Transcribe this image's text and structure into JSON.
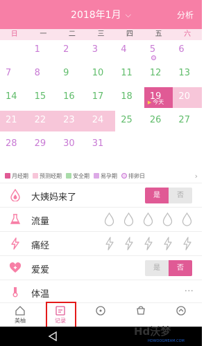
{
  "header": {
    "title": "2018年1月",
    "analysis": "分析"
  },
  "weekdays": [
    "日",
    "一",
    "二",
    "三",
    "四",
    "五",
    "六"
  ],
  "calendar": {
    "rows": [
      [
        "",
        "1",
        "2",
        "3",
        "4",
        "5",
        "6"
      ],
      [
        "7",
        "8",
        "9",
        "10",
        "11",
        "12",
        "13"
      ],
      [
        "14",
        "15",
        "16",
        "17",
        "18",
        "19",
        "20"
      ],
      [
        "21",
        "22",
        "23",
        "24",
        "25",
        "26",
        "27"
      ],
      [
        "28",
        "29",
        "30",
        "31",
        "",
        "",
        ""
      ]
    ],
    "today_label": "今天"
  },
  "legend": [
    "月经期",
    "预测经期",
    "安全期",
    "易孕期",
    "排卵日"
  ],
  "records": {
    "period": {
      "label": "大姨妈来了",
      "yes": "是",
      "no": "否",
      "value": "是"
    },
    "flow": {
      "label": "流量"
    },
    "cramps": {
      "label": "痛经"
    },
    "love": {
      "label": "爱爱",
      "yes": "是",
      "no": "否",
      "value": "否"
    },
    "temperature": {
      "label": "体温",
      "more": "···"
    }
  },
  "tabs": [
    {
      "label": "美柚",
      "icon": "home-icon"
    },
    {
      "label": "记录",
      "icon": "record-icon"
    },
    {
      "label": "",
      "icon": "compass-icon"
    },
    {
      "label": "",
      "icon": "cup-icon"
    },
    {
      "label": "",
      "icon": "user-icon"
    }
  ],
  "watermark": {
    "brand": "Hd沃梦",
    "url": "HDWOOGMEAM.COM"
  },
  "colors": {
    "primary": "#f77fa6",
    "today": "#e05a95",
    "period": "#f7c6d9",
    "safe": "#5fbc6a",
    "fertile": "#c879d4"
  }
}
